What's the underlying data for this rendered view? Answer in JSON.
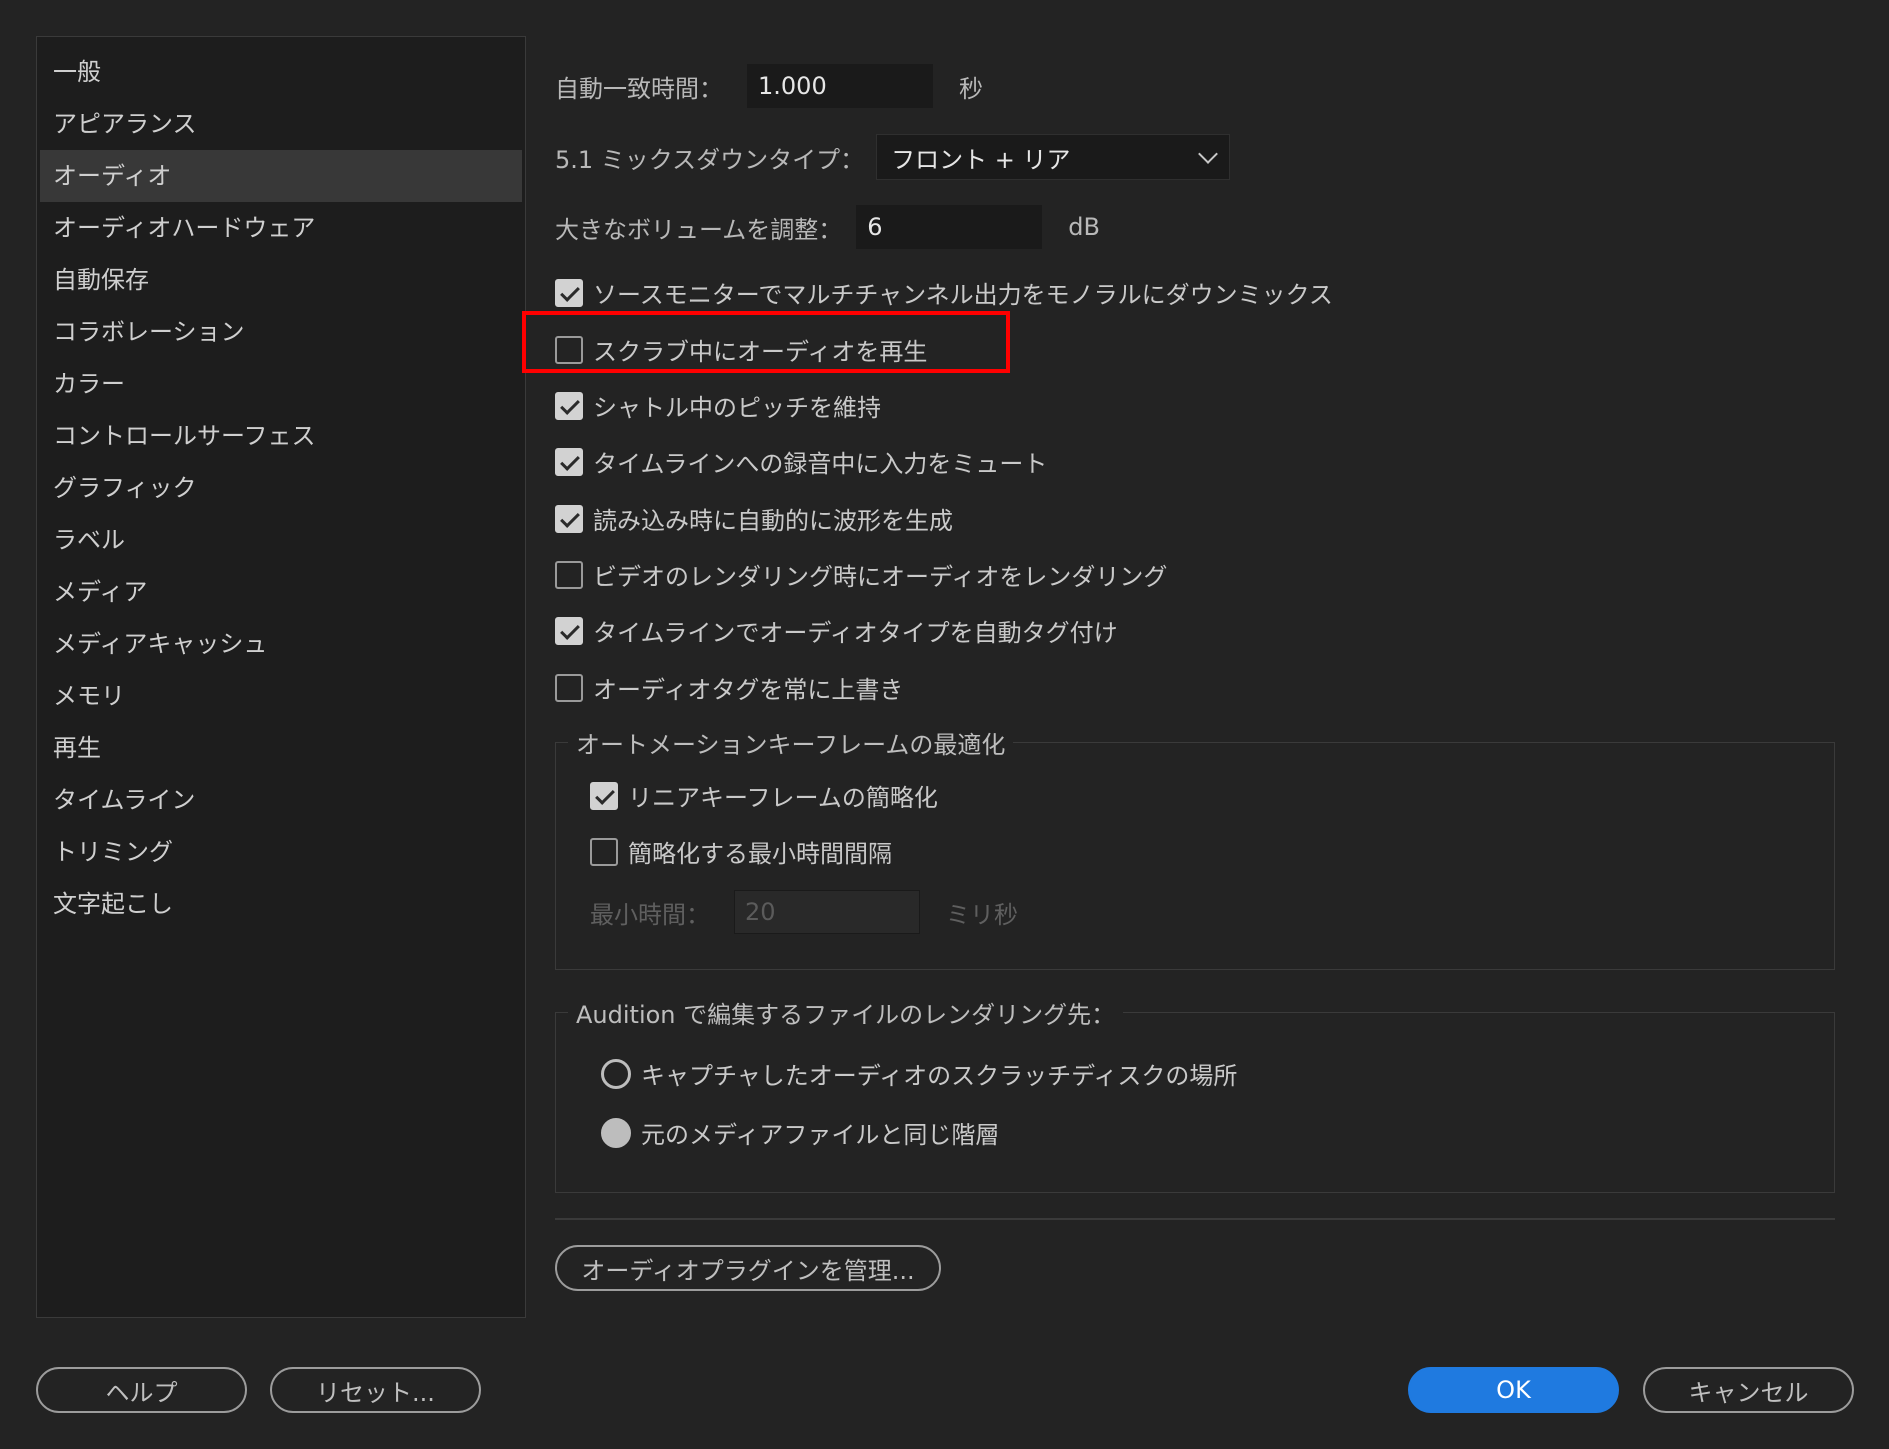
{
  "sidebar": {
    "items": [
      {
        "label": "一般"
      },
      {
        "label": "アピアランス"
      },
      {
        "label": "オーディオ"
      },
      {
        "label": "オーディオハードウェア"
      },
      {
        "label": "自動保存"
      },
      {
        "label": "コラボレーション"
      },
      {
        "label": "カラー"
      },
      {
        "label": "コントロールサーフェス"
      },
      {
        "label": "グラフィック"
      },
      {
        "label": "ラベル"
      },
      {
        "label": "メディア"
      },
      {
        "label": "メディアキャッシュ"
      },
      {
        "label": "メモリ"
      },
      {
        "label": "再生"
      },
      {
        "label": "タイムライン"
      },
      {
        "label": "トリミング"
      },
      {
        "label": "文字起こし"
      }
    ],
    "active": "オーディオ"
  },
  "audio": {
    "auto_match": {
      "label": "自動一致時間：",
      "value": "1.000",
      "unit": "秒"
    },
    "mixdown": {
      "label": "5.1 ミックスダウンタイプ：",
      "value": "フロント + リア"
    },
    "loud_volume": {
      "label": "大きなボリュームを調整：",
      "value": "6",
      "unit": "dB"
    },
    "checkboxes": [
      {
        "label": "ソースモニターでマルチチャンネル出力をモノラルにダウンミックス",
        "checked": true
      },
      {
        "label": "スクラブ中にオーディオを再生",
        "checked": false
      },
      {
        "label": "シャトル中のピッチを維持",
        "checked": true
      },
      {
        "label": "タイムラインへの録音中に入力をミュート",
        "checked": true
      },
      {
        "label": "読み込み時に自動的に波形を生成",
        "checked": true
      },
      {
        "label": "ビデオのレンダリング時にオーディオをレンダリング",
        "checked": false
      },
      {
        "label": "タイムラインでオーディオタイプを自動タグ付け",
        "checked": true
      },
      {
        "label": "オーディオタグを常に上書き",
        "checked": false
      }
    ],
    "automation": {
      "title": "オートメーションキーフレームの最適化",
      "linear": {
        "label": "リニアキーフレームの簡略化",
        "checked": true
      },
      "min_interval": {
        "label": "簡略化する最小時間間隔",
        "checked": false
      },
      "min_time": {
        "label": "最小時間：",
        "value": "20",
        "unit": "ミリ秒"
      }
    },
    "audition": {
      "title": "Audition で編集するファイルのレンダリング先：",
      "options": [
        {
          "label": "キャプチャしたオーディオのスクラッチディスクの場所",
          "selected": false
        },
        {
          "label": "元のメディアファイルと同じ階層",
          "selected": true
        }
      ]
    },
    "manage_plugins_label": "オーディオプラグインを管理..."
  },
  "footer": {
    "help": "ヘルプ",
    "reset": "リセット...",
    "ok": "OK",
    "cancel": "キャンセル"
  },
  "colors": {
    "accent": "#1f7ae0",
    "highlight": "#ff0000"
  }
}
